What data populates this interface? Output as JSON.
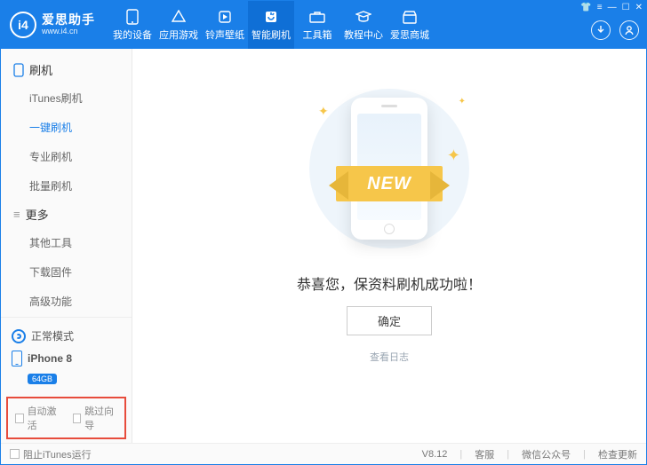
{
  "logo": {
    "mark": "i4",
    "cn": "爱思助手",
    "url": "www.i4.cn"
  },
  "nav": [
    {
      "label": "我的设备"
    },
    {
      "label": "应用游戏"
    },
    {
      "label": "铃声壁纸"
    },
    {
      "label": "智能刷机"
    },
    {
      "label": "工具箱"
    },
    {
      "label": "教程中心"
    },
    {
      "label": "爱思商城"
    }
  ],
  "nav_active_index": 3,
  "sidebar": {
    "group1_title": "刷机",
    "group1_items": [
      "iTunes刷机",
      "一键刷机",
      "专业刷机",
      "批量刷机"
    ],
    "group1_active_index": 1,
    "group2_title": "更多",
    "group2_items": [
      "其他工具",
      "下载固件",
      "高级功能"
    ],
    "mode_label": "正常模式",
    "device_name": "iPhone 8",
    "device_storage": "64GB",
    "check_auto_activate": "自动激活",
    "check_skip_guide": "跳过向导"
  },
  "main": {
    "ribbon_text": "NEW",
    "success_text": "恭喜您，保资料刷机成功啦！",
    "ok_button": "确定",
    "view_log": "查看日志"
  },
  "footer": {
    "block_itunes": "阻止iTunes运行",
    "version": "V8.12",
    "links": [
      "客服",
      "微信公众号",
      "检查更新"
    ]
  }
}
